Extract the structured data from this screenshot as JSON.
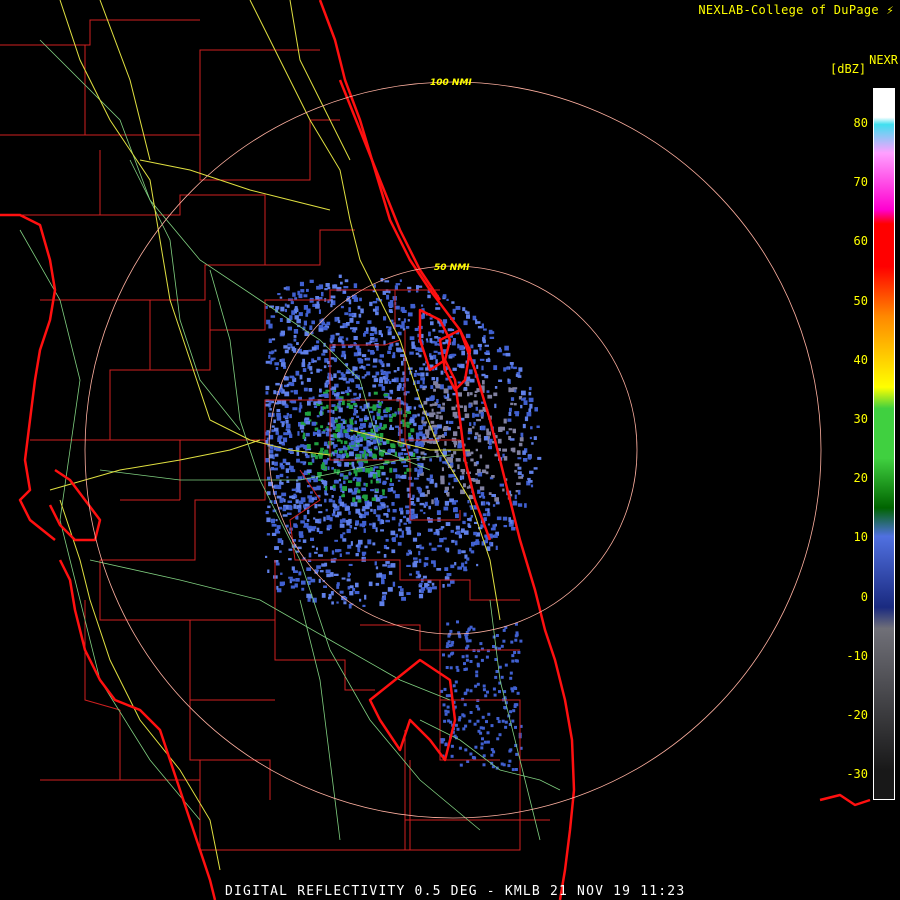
{
  "header": {
    "credit": "NEXLAB-College of DuPage",
    "product": "NEXR",
    "unit": "[dBZ]"
  },
  "caption": "DIGITAL REFLECTIVITY 0.5 DEG - KMLB 21 NOV 19 11:23",
  "range_rings": [
    {
      "label": "100 NMI"
    },
    {
      "label": "50 NMI"
    }
  ],
  "legend": {
    "ticks": [
      "80",
      "70",
      "60",
      "50",
      "40",
      "30",
      "20",
      "10",
      "0",
      "-10",
      "-20",
      "-30"
    ],
    "colors": {
      "top": "#ffffff",
      "cyan": "#40e0f0",
      "pink": "#ffa0ff",
      "magenta": "#ff00d0",
      "red": "#ff0000",
      "orange": "#ff8800",
      "yellow": "#ffff00",
      "green": "#40d040",
      "dark_green": "#006400",
      "blue": "#5070e0",
      "navy": "#1a2a80",
      "gray": "#707078",
      "dark": "#181818"
    }
  },
  "map_colors": {
    "coast": "#ff1010",
    "county": "#d02020",
    "highway": "#e0e040",
    "road": "#80d080",
    "ring": "#ffb0a0",
    "echo_blue": "#4060d0",
    "echo_light_blue": "#6080e8",
    "echo_green": "#20a040",
    "echo_gray": "#8080a0"
  }
}
